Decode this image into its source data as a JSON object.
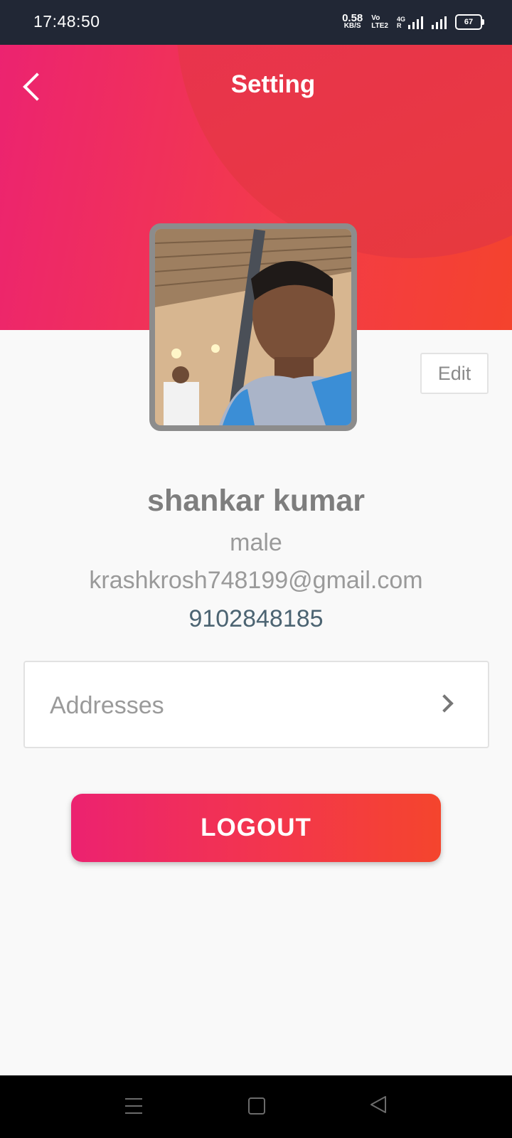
{
  "status_bar": {
    "time": "17:48:50",
    "speed_value": "0.58",
    "speed_unit": "KB/S",
    "volte_top": "Vo",
    "volte_bottom": "LTE2",
    "net_top": "4G",
    "net_bottom": "R",
    "battery": "67"
  },
  "header": {
    "title": "Setting",
    "back_icon": "chevron-left-icon"
  },
  "profile": {
    "edit_label": "Edit",
    "name": "shankar kumar",
    "gender": "male",
    "email": "krashkrosh748199@gmail.com",
    "phone": "9102848185"
  },
  "menu": {
    "addresses_label": "Addresses",
    "addresses_icon": "chevron-right-icon"
  },
  "logout": {
    "label": "LOGOUT"
  },
  "colors": {
    "gradient_start": "#ec2370",
    "gradient_end": "#f4432d",
    "status_bar": "#212735",
    "background": "#f9f9f9",
    "phone_text": "#4c6472"
  }
}
